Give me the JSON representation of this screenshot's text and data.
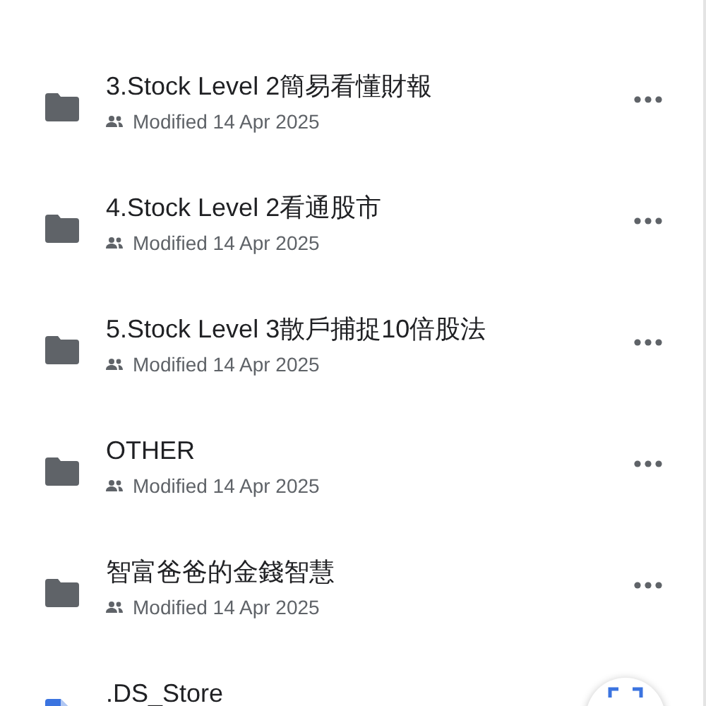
{
  "items": [
    {
      "kind": "folder",
      "title": "3.Stock Level 2簡易看懂財報",
      "subtitle": "Modified 14 Apr 2025"
    },
    {
      "kind": "folder",
      "title": "4.Stock Level 2看通股市",
      "subtitle": "Modified 14 Apr 2025"
    },
    {
      "kind": "folder",
      "title": "5.Stock Level 3散戶捕捉10倍股法",
      "subtitle": "Modified 14 Apr 2025"
    },
    {
      "kind": "folder",
      "title": "OTHER",
      "subtitle": "Modified 14 Apr 2025"
    },
    {
      "kind": "folder",
      "title": "智富爸爸的金錢智慧",
      "subtitle": "Modified 14 Apr 2025"
    },
    {
      "kind": "file",
      "title": ".DS_Store"
    }
  ],
  "fab": {
    "kind": "scan"
  }
}
